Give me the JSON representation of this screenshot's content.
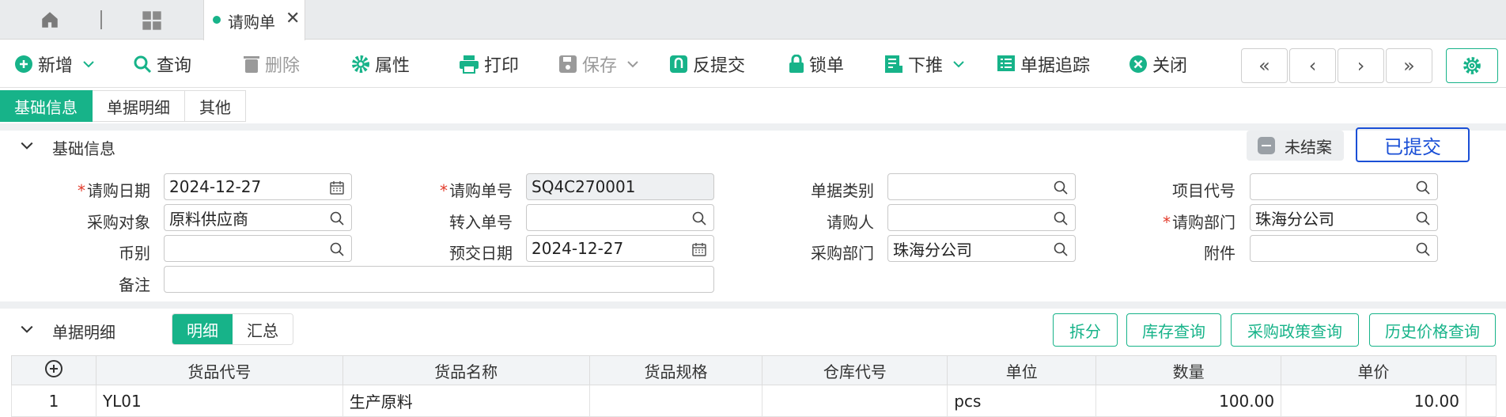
{
  "tabs": {
    "active_label": "请购单"
  },
  "toolbar": {
    "add": "新增",
    "query": "查询",
    "delete": "删除",
    "props": "属性",
    "print": "打印",
    "save": "保存",
    "unsubmit": "反提交",
    "lock": "锁单",
    "push": "下推",
    "trace": "单据追踪",
    "close": "关闭"
  },
  "section_tabs": [
    "基础信息",
    "单据明细",
    "其他"
  ],
  "basic": {
    "title": "基础信息",
    "status": "未结案",
    "state_button": "已提交",
    "labels": {
      "req_date": "请购日期",
      "req_no": "请购单号",
      "doc_type": "单据类别",
      "project_code": "项目代号",
      "purchase_target": "采购对象",
      "transfer_no": "转入单号",
      "requester": "请购人",
      "req_dept": "请购部门",
      "currency": "币别",
      "expected_date": "预交日期",
      "purchase_dept": "采购部门",
      "attachment": "附件",
      "remark": "备注"
    },
    "values": {
      "req_date": "2024-12-27",
      "req_no": "SQ4C270001",
      "doc_type": "",
      "project_code": "",
      "purchase_target": "原料供应商",
      "transfer_no": "",
      "requester": "",
      "req_dept": "珠海分公司",
      "currency": "",
      "expected_date": "2024-12-27",
      "purchase_dept": "珠海分公司",
      "attachment": "",
      "remark": ""
    }
  },
  "detail": {
    "title": "单据明细",
    "subtabs": [
      "明细",
      "汇总"
    ],
    "actions": [
      "拆分",
      "库存查询",
      "采购政策查询",
      "历史价格查询"
    ],
    "columns": [
      "货品代号",
      "货品名称",
      "货品规格",
      "仓库代号",
      "单位",
      "数量",
      "单价"
    ],
    "rows": [
      {
        "idx": "1",
        "code": "YL01",
        "name": "生产原料",
        "spec": "",
        "wh": "",
        "unit": "pcs",
        "qty": "100.00",
        "price": "10.00"
      }
    ]
  },
  "colors": {
    "accent": "#17b389",
    "required": "#e23a2a",
    "submitted": "#1a4fd6"
  }
}
